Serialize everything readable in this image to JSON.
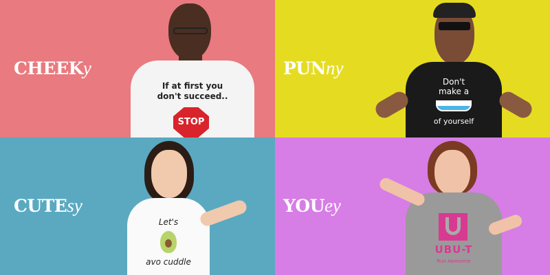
{
  "panels": [
    {
      "title_bold": "CHEEK",
      "title_italic": "y",
      "color": "#e97a7f",
      "shirt_text": "If at first you don't succeed..",
      "sign_text": "STOP"
    },
    {
      "title_bold": "PUN",
      "title_italic": "ny",
      "color": "#e5dc22",
      "shirt_line1": "Don't",
      "shirt_line2": "make a",
      "shirt_line3": "of yourself"
    },
    {
      "title_bold": "CUTE",
      "title_italic": "sy",
      "color": "#5aa9c1",
      "shirt_line1": "Let's",
      "shirt_line2": "avo cuddle"
    },
    {
      "title_bold": "YOU",
      "title_italic": "ey",
      "color": "#d77de6",
      "logo_text": "UBU-T",
      "tagline": "Run Awesome"
    }
  ]
}
